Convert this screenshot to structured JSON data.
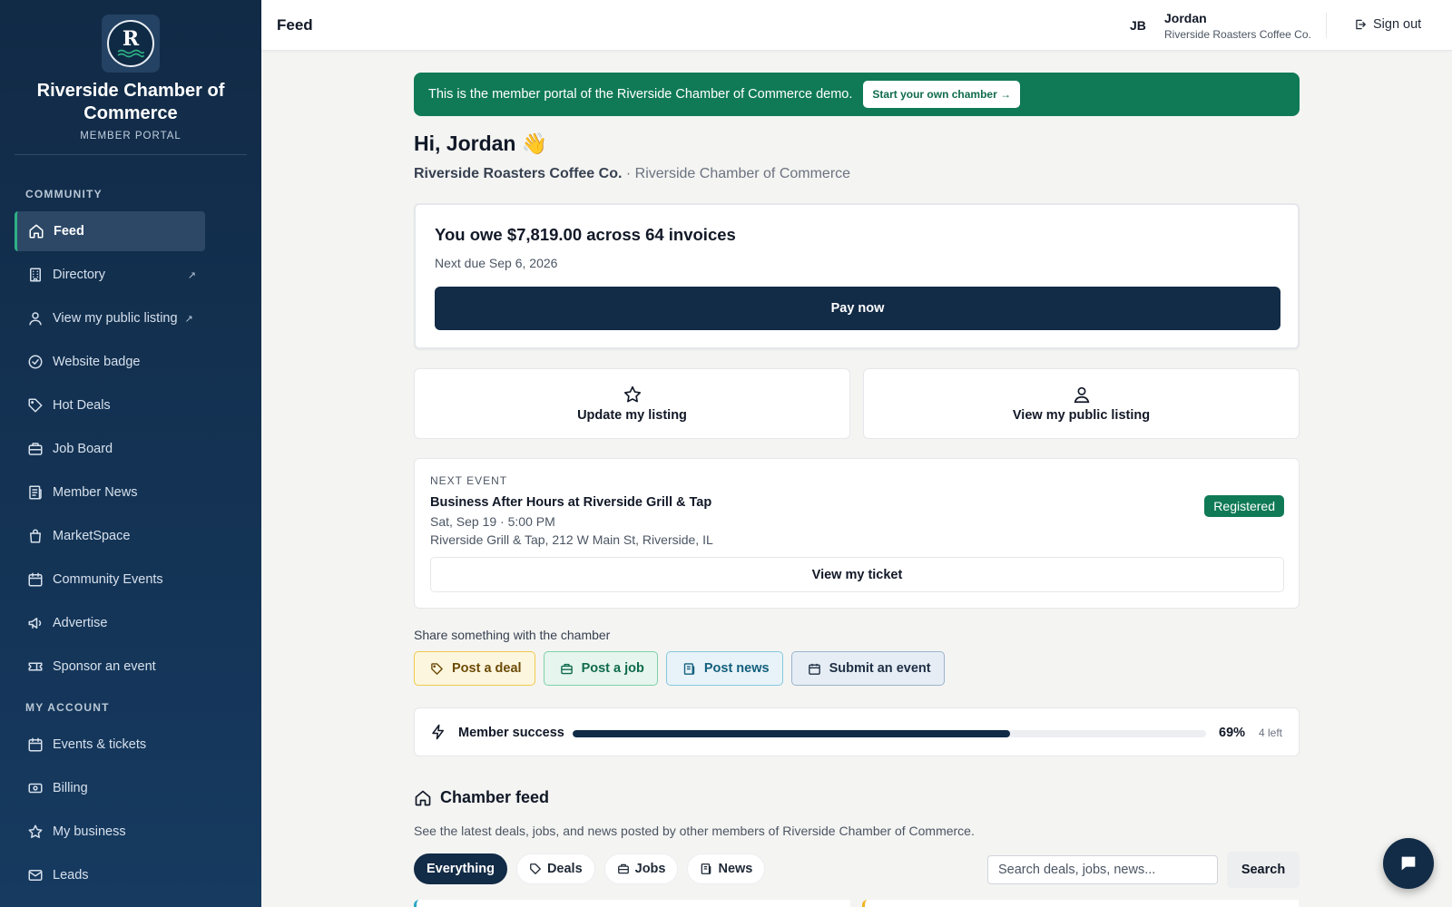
{
  "sidebar": {
    "org_name": "Riverside Chamber of Commerce",
    "logo_letter": "R",
    "portal_label": "MEMBER PORTAL",
    "community_label": "COMMUNITY",
    "account_label": "MY ACCOUNT",
    "community_items": [
      {
        "label": "Feed",
        "icon": "home-icon"
      },
      {
        "label": "Directory",
        "icon": "building-icon",
        "external": "↗"
      },
      {
        "label": "View my public listing",
        "icon": "user-icon",
        "external": "↗"
      },
      {
        "label": "Website badge",
        "icon": "check-circle-icon"
      },
      {
        "label": "Hot Deals",
        "icon": "tag-icon"
      },
      {
        "label": "Job Board",
        "icon": "briefcase-icon"
      },
      {
        "label": "Member News",
        "icon": "newspaper-icon"
      },
      {
        "label": "MarketSpace",
        "icon": "shopping-bag-icon"
      },
      {
        "label": "Community Events",
        "icon": "calendar-icon"
      },
      {
        "label": "Advertise",
        "icon": "megaphone-icon"
      },
      {
        "label": "Sponsor an event",
        "icon": "ticket-icon"
      }
    ],
    "account_items": [
      {
        "label": "Events & tickets",
        "icon": "calendar-icon"
      },
      {
        "label": "Billing",
        "icon": "banknote-icon"
      },
      {
        "label": "My business",
        "icon": "star-icon"
      },
      {
        "label": "Leads",
        "icon": "mail-icon"
      }
    ]
  },
  "topbar": {
    "title": "Feed",
    "user_initials": "JB",
    "user_name": "Jordan",
    "user_org": "Riverside Roasters Coffee Co.",
    "signout_label": "Sign out"
  },
  "banner": {
    "text": "This is the member portal of the Riverside Chamber of Commerce demo.",
    "cta": "Start your own chamber →"
  },
  "greeting": {
    "title": "Hi, Jordan 👋",
    "business": "Riverside Roasters Coffee Co.",
    "separator": "·",
    "chamber": "Riverside Chamber of Commerce"
  },
  "billing": {
    "title": "You owe $7,819.00 across 64 invoices",
    "next_due": "Next due Sep 6, 2026",
    "pay_label": "Pay now"
  },
  "actions": {
    "update_listing": "Update my listing",
    "view_listing": "View my public listing"
  },
  "event": {
    "label": "NEXT EVENT",
    "title": "Business After Hours at Riverside Grill & Tap",
    "time": "Sat, Sep 19 · 5:00 PM",
    "location": "Riverside Grill & Tap, 212 W Main St, Riverside, IL",
    "status": "Registered",
    "ticket_label": "View my ticket"
  },
  "share": {
    "label": "Share something with the chamber",
    "deal": "Post a deal",
    "job": "Post a job",
    "news": "Post news",
    "event": "Submit an event"
  },
  "success": {
    "label": "Member success",
    "percent_value": 69,
    "percent": "69%",
    "left": "4 left"
  },
  "feed": {
    "title": "Chamber feed",
    "subtitle": "See the latest deals, jobs, and news posted by other members of Riverside Chamber of Commerce.",
    "filters": {
      "everything": "Everything",
      "deals": "Deals",
      "jobs": "Jobs",
      "news": "News"
    },
    "search_placeholder": "Search deals, jobs, news...",
    "search_label": "Search"
  },
  "colors": {
    "sidebar_bg": "#112a46",
    "accent_green": "#107a57",
    "navy": "#122b46"
  }
}
